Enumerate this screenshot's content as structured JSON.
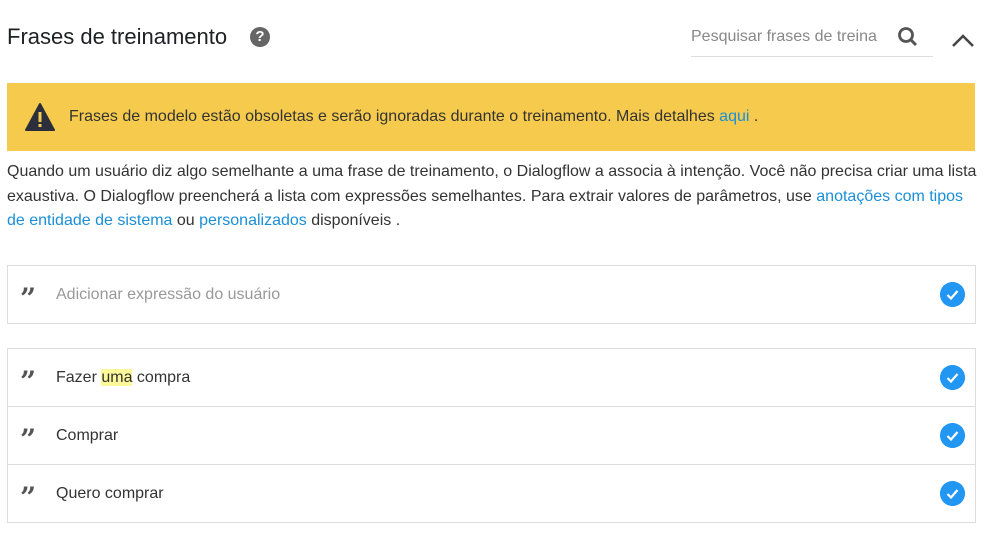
{
  "header": {
    "title": "Frases de treinamento",
    "search_placeholder": "Pesquisar frases de treina"
  },
  "banner": {
    "text": "Frases de modelo estão obsoletas e serão ignoradas durante o treinamento. Mais detalhes ",
    "link": "aqui",
    "suffix": " .",
    "color": "#f6ca4c"
  },
  "description": {
    "text": "Quando um usuário diz algo semelhante a uma frase de treinamento, o Dialogflow a associa à intenção. Você não precisa criar uma lista exaustiva. O Dialogflow preencherá a lista com expressões semelhantes. Para extrair valores de parâmetros, use ",
    "link1": "anotações com tipos de entidade de sistema",
    "mid": " ou ",
    "link2": "personalizados",
    "end": " disponíveis ."
  },
  "add_phrase": {
    "placeholder": "Adicionar expressão do usuário"
  },
  "phrases": [
    {
      "before": "Fazer ",
      "highlight": "uma",
      "after": " compra"
    },
    {
      "before": "Comprar",
      "highlight": "",
      "after": ""
    },
    {
      "before": "Quero comprar",
      "highlight": "",
      "after": ""
    }
  ],
  "accent": "#2196f3"
}
